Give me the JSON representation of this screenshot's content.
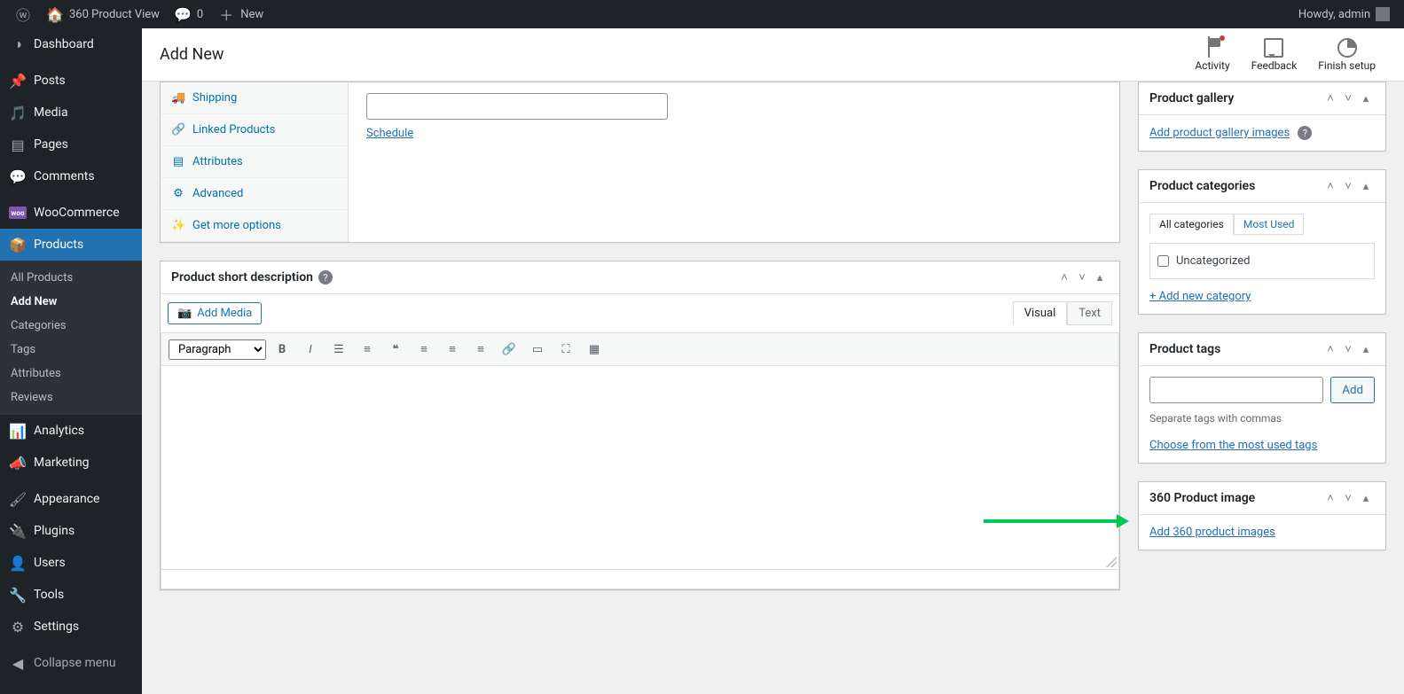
{
  "adminbar": {
    "site_title": "360 Product View",
    "comments_count": "0",
    "new_label": "New",
    "howdy": "Howdy, admin"
  },
  "sidebar": {
    "items": [
      {
        "icon": "dash",
        "label": "Dashboard"
      },
      {
        "icon": "pin",
        "label": "Posts"
      },
      {
        "icon": "media",
        "label": "Media"
      },
      {
        "icon": "page",
        "label": "Pages"
      },
      {
        "icon": "comment",
        "label": "Comments"
      },
      {
        "icon": "woo",
        "label": "WooCommerce"
      },
      {
        "icon": "product",
        "label": "Products"
      },
      {
        "icon": "analytics",
        "label": "Analytics"
      },
      {
        "icon": "marketing",
        "label": "Marketing"
      },
      {
        "icon": "appearance",
        "label": "Appearance"
      },
      {
        "icon": "plugin",
        "label": "Plugins"
      },
      {
        "icon": "users",
        "label": "Users"
      },
      {
        "icon": "tools",
        "label": "Tools"
      },
      {
        "icon": "settings",
        "label": "Settings"
      }
    ],
    "products_submenu": [
      "All Products",
      "Add New",
      "Categories",
      "Tags",
      "Attributes",
      "Reviews"
    ],
    "collapse_label": "Collapse menu"
  },
  "header": {
    "page_title": "Add New",
    "activity": "Activity",
    "feedback": "Feedback",
    "finish": "Finish setup"
  },
  "product_data": {
    "tabs": [
      "Shipping",
      "Linked Products",
      "Attributes",
      "Advanced",
      "Get more options"
    ],
    "schedule_label": "Schedule"
  },
  "short_desc": {
    "title": "Product short description",
    "add_media": "Add Media",
    "visual": "Visual",
    "text": "Text",
    "paragraph": "Paragraph"
  },
  "gallery_box": {
    "title": "Product gallery",
    "link": "Add product gallery images"
  },
  "cat_box": {
    "title": "Product categories",
    "tab_all": "All categories",
    "tab_most": "Most Used",
    "uncat": "Uncategorized",
    "add_new": "+ Add new category"
  },
  "tag_box": {
    "title": "Product tags",
    "add": "Add",
    "sep": "Separate tags with commas",
    "choose": "Choose from the most used tags"
  },
  "img360_box": {
    "title": "360 Product image",
    "link": "Add 360 product images"
  }
}
